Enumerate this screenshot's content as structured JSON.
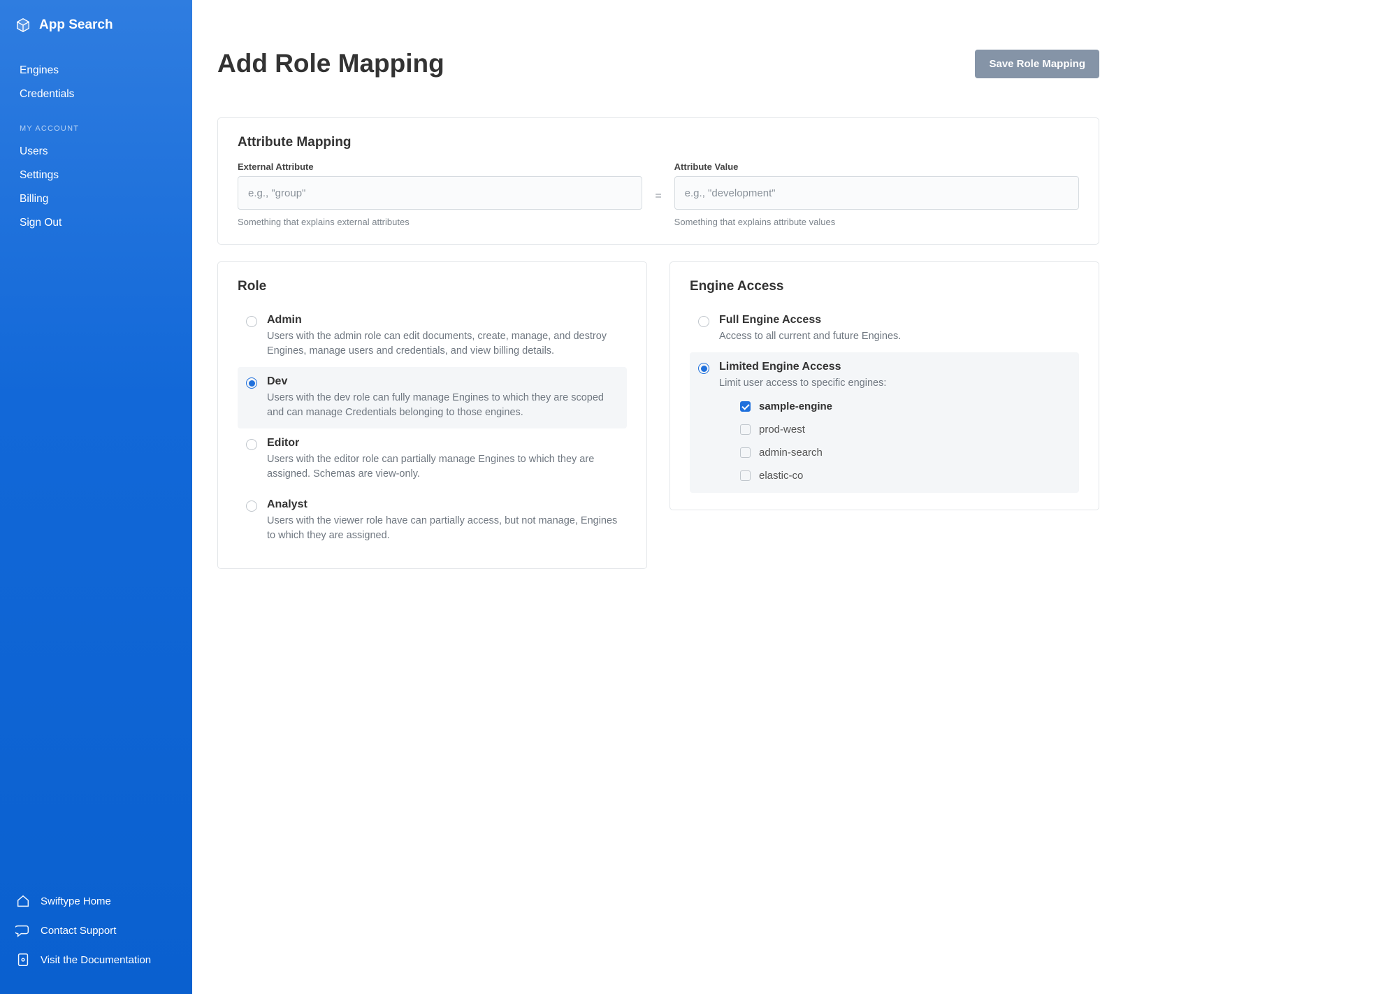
{
  "brand": {
    "title": "App Search"
  },
  "sidebar": {
    "primary": [
      {
        "label": "Engines"
      },
      {
        "label": "Credentials"
      }
    ],
    "account_label": "MY ACCOUNT",
    "account": [
      {
        "label": "Users"
      },
      {
        "label": "Settings"
      },
      {
        "label": "Billing"
      },
      {
        "label": "Sign Out"
      }
    ],
    "footer": [
      {
        "label": "Swiftype Home",
        "icon": "home"
      },
      {
        "label": "Contact Support",
        "icon": "chat"
      },
      {
        "label": "Visit the Documentation",
        "icon": "doc"
      }
    ]
  },
  "page": {
    "title": "Add Role Mapping",
    "save_button": "Save Role Mapping"
  },
  "attrmap": {
    "title": "Attribute Mapping",
    "ext_label": "External Attribute",
    "ext_placeholder": "e.g., \"group\"",
    "ext_help": "Something that explains external attributes",
    "equals": "=",
    "val_label": "Attribute Value",
    "val_placeholder": "e.g., \"development\"",
    "val_help": "Something that explains attribute values"
  },
  "role": {
    "title": "Role",
    "options": [
      {
        "name": "Admin",
        "desc": "Users with the admin role can edit documents, create, manage, and destroy Engines, manage users and credentials, and view billing details.",
        "selected": false
      },
      {
        "name": "Dev",
        "desc": "Users with the dev role can fully manage Engines to which they are scoped and can manage Credentials belonging to those engines.",
        "selected": true
      },
      {
        "name": "Editor",
        "desc": "Users with the editor role can partially manage Engines to which they are assigned. Schemas are view-only.",
        "selected": false
      },
      {
        "name": "Analyst",
        "desc": "Users with the viewer role have can partially access, but not manage, Engines to which they are assigned.",
        "selected": false
      }
    ]
  },
  "engine": {
    "title": "Engine Access",
    "options": [
      {
        "name": "Full Engine Access",
        "desc": "Access to all current and future Engines.",
        "selected": false
      },
      {
        "name": "Limited Engine Access",
        "desc": "Limit user access to specific engines:",
        "selected": true
      }
    ],
    "engines": [
      {
        "label": "sample-engine",
        "checked": true
      },
      {
        "label": "prod-west",
        "checked": false
      },
      {
        "label": "admin-search",
        "checked": false
      },
      {
        "label": "elastic-co",
        "checked": false
      }
    ]
  }
}
